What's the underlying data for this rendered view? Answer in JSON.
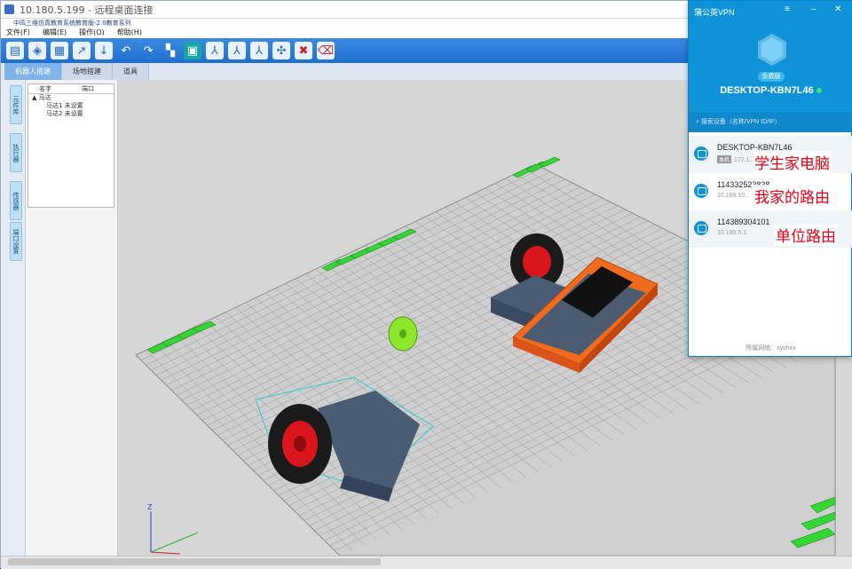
{
  "rdp": {
    "title": "10.180.5.199 - 远程桌面连接"
  },
  "app": {
    "title": "中鸣三维仿真教育系统教育版-2.0教育系列",
    "menus": [
      "文件(F)",
      "编辑(E)",
      "操作(O)",
      "帮助(H)"
    ],
    "tabs": [
      "机器人搭建",
      "场地搭建",
      "道具"
    ],
    "side_tabs": [
      "元件库",
      "执行器",
      "传感器",
      "端口设置"
    ],
    "tree": {
      "col_name": "名字",
      "col_port": "端口",
      "root": "马达",
      "children": [
        "马达1  未设置",
        "马达2  未设置"
      ]
    },
    "axis_label": "Z"
  },
  "vpn": {
    "title": "蒲公英VPN",
    "badge": "免费版",
    "hostname": "DESKTOP-KBN7L46",
    "search_placeholder": "搜索设备（名称/VPN ID/IP）",
    "devices": [
      {
        "name": "DESKTOP-KBN7L46",
        "tag": "本机",
        "ip": "172.1..."
      },
      {
        "name": "114332523838",
        "tag": "",
        "ip": "10.168.10..."
      },
      {
        "name": "114389304101",
        "tag": "",
        "ip": "10.180.5.1"
      }
    ],
    "footer": "所属网络：sychxx",
    "status_color": "#3ee07a",
    "accent": "#0e93d8"
  },
  "annotations": [
    "学生家电脑",
    "我家的路由",
    "单位路由"
  ]
}
